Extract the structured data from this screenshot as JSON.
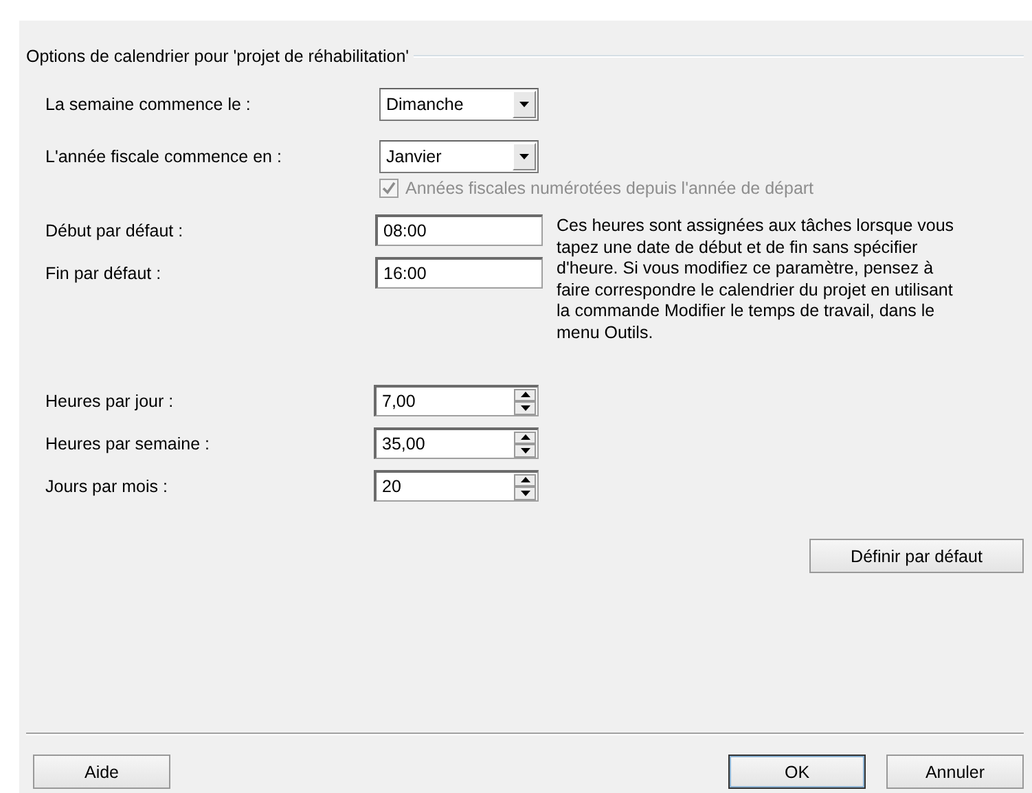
{
  "group_title": "Options de calendrier pour 'projet de réhabilitation'",
  "dropdowns": [
    {
      "label": "La semaine commence le :",
      "value": "Dimanche"
    },
    {
      "label": "L'année fiscale commence en :",
      "value": "Janvier"
    }
  ],
  "fiscal_numbering": {
    "label": "Années fiscales numérotées depuis l'année de départ",
    "checked": true,
    "disabled": true
  },
  "times": [
    {
      "label": "Début par défaut :",
      "value": "08:00"
    },
    {
      "label": "Fin par défaut :",
      "value": "16:00"
    }
  ],
  "note": "Ces heures sont assignées aux tâches lorsque vous tapez une date de début et de fin sans spécifier d'heure. Si vous modifiez ce paramètre, pensez à faire correspondre le calendrier du projet en utilisant la commande Modifier le temps de travail, dans le menu Outils.",
  "spinners": [
    {
      "label": "Heures par jour :",
      "value": "7,00"
    },
    {
      "label": "Heures par semaine :",
      "value": "35,00"
    },
    {
      "label": "Jours par mois :",
      "value": "20"
    }
  ],
  "set_default_button": "Définir par défaut",
  "left_buttons": [
    {
      "label": "Aide",
      "default": false
    }
  ],
  "right_buttons": [
    {
      "label": "OK",
      "default": true
    },
    {
      "label": "Annuler",
      "default": false
    }
  ]
}
